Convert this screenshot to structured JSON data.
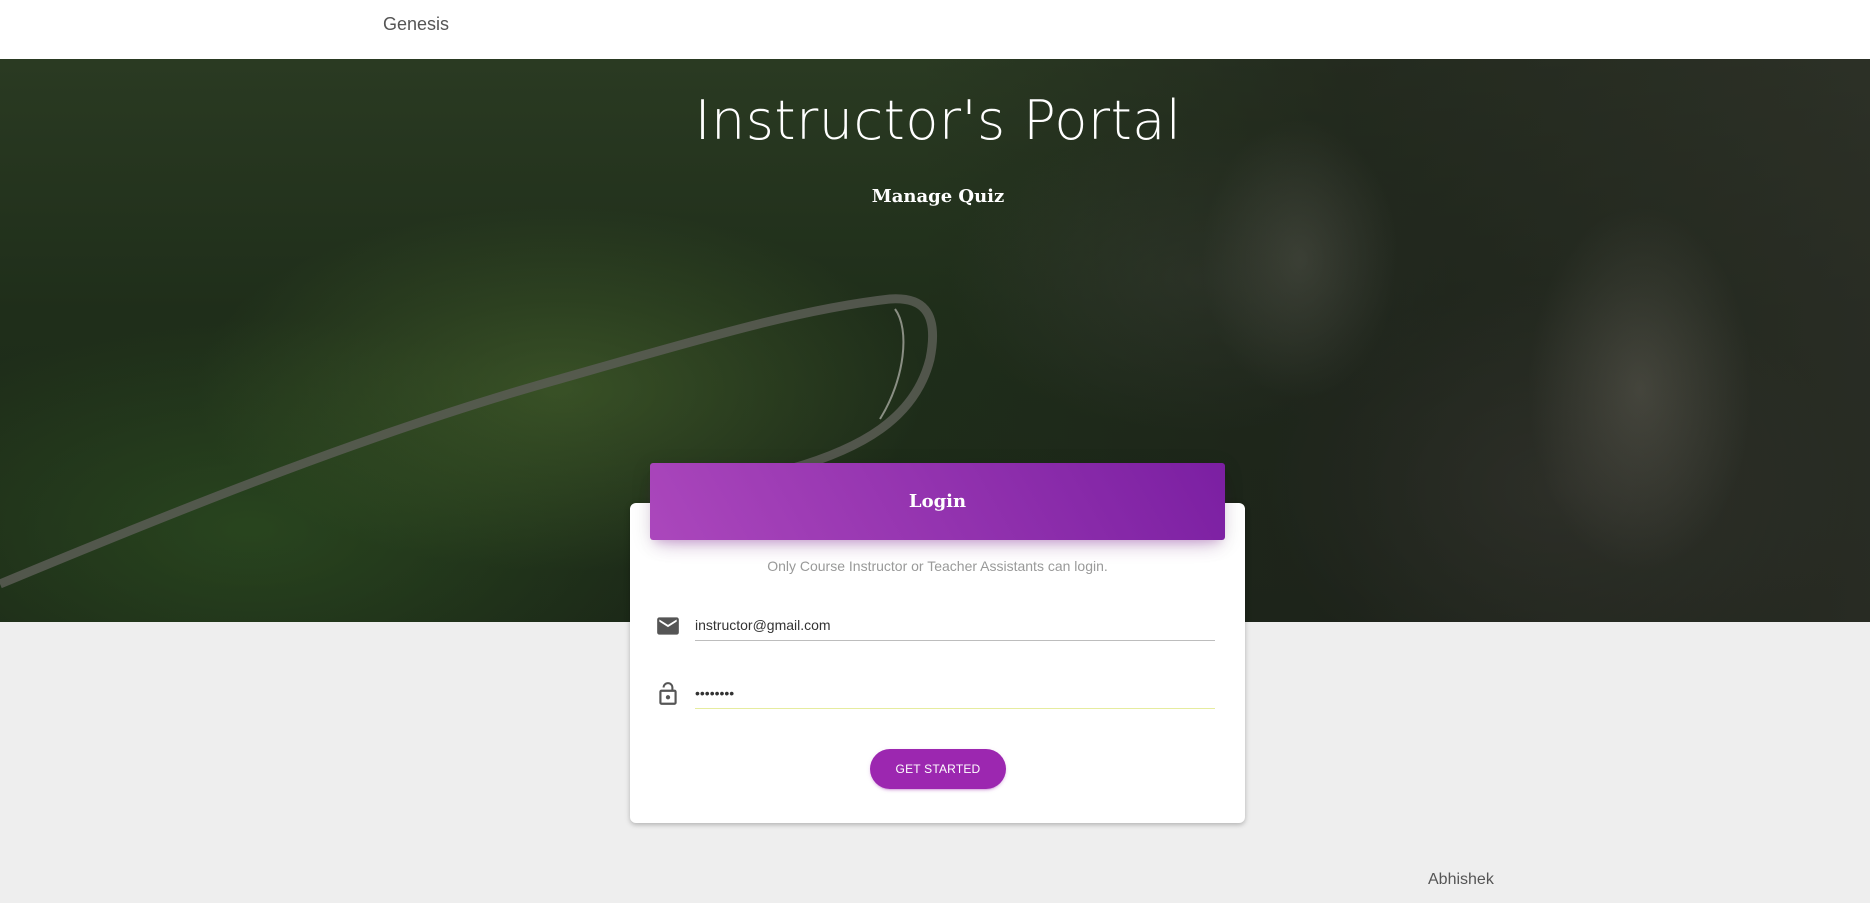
{
  "navbar": {
    "brand": "Genesis"
  },
  "hero": {
    "title": "Instructor's Portal",
    "subtitle": "Manage Quiz"
  },
  "login_card": {
    "header_title": "Login",
    "description": "Only Course Instructor or Teacher Assistants can login.",
    "email_field": {
      "value": "instructor@gmail.com",
      "icon": "mail-icon"
    },
    "password_field": {
      "value": "••••••••",
      "icon": "lock-icon"
    },
    "submit_label": "GET STARTED"
  },
  "footer": {
    "credit": "Abhishek"
  },
  "colors": {
    "accent": "#9c27b0",
    "header_gradient_start": "#ab47bc",
    "header_gradient_end": "#7b1fa2",
    "page_background": "#eeeeee"
  }
}
